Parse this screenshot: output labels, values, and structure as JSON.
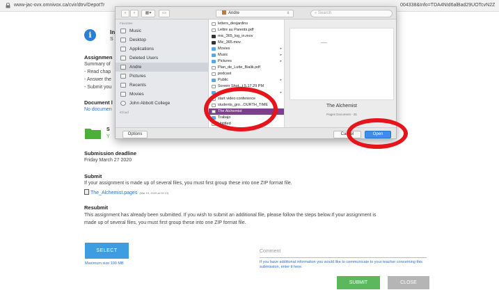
{
  "browser": {
    "url_left": "www-jac-ovx.omnivox.ca/cvir/dtrv/DepotTr",
    "url_right": "004338&Info=TDA4NId6alBad29UOTcvN2Z"
  },
  "page": {
    "partial_heading": "In",
    "partial_sub": "S",
    "assignment_title": "Assignmen",
    "summary_lines": [
      "Summary of",
      "- Read chap",
      "- Answer the",
      "- Submit you"
    ],
    "document_title": "Document l",
    "document_link": "No documen",
    "folder_letter": "S",
    "folder_sub": "Y",
    "deadline_title": "Submission deadline",
    "deadline_value": "Friday March 27 2020",
    "submit_title": "Submit",
    "submit_text": "If your assignment is made up of several files, you must first group these into one ZIP format file.",
    "file_name": "The_Alchemist.pages",
    "file_meta": "(Mar 19, 2020 at 10:13)",
    "resubmit_title": "Resubmit",
    "resubmit_line1": "This assignment has already been submitted. If you wish to submit an additional file, please follow the steps below.If your assignment is",
    "resubmit_line2": "made up of several files, you must first group these into one ZIP format file.",
    "select_label": "SELECT",
    "max_size": "Maximum size 100 MB",
    "comment_placeholder": "Comment",
    "comment_hint": "If you have additional information you would like to communicate to your teacher concerning this submission, enter it here.",
    "submit_label": "SUBMIT",
    "close_label": "CLOSE"
  },
  "dialog": {
    "location": "Andre",
    "search_placeholder": "Search",
    "sidebar_heading_favorites": "Favorites",
    "sidebar_heading_icloud": "iCloud",
    "sidebar_items": [
      "Music",
      "Desktop",
      "Applications",
      "Deleted Users",
      "Andre",
      "Pictures",
      "Recents",
      "Movies",
      "John Abbott College"
    ],
    "files": [
      {
        "name": "letters_desjardins",
        "kind": "doc"
      },
      {
        "name": "Lettre au Parents.pdf",
        "kind": "doc"
      },
      {
        "name": "mic_365_log_in.mov",
        "kind": "dark"
      },
      {
        "name": "Mic_365.mov",
        "kind": "dark"
      },
      {
        "name": "Movies",
        "kind": "folder",
        "arrow": "▸"
      },
      {
        "name": "Music",
        "kind": "folder",
        "arrow": "▸"
      },
      {
        "name": "Pictures",
        "kind": "folder",
        "arrow": "▸"
      },
      {
        "name": "Plan_de_Lutte_Bialik.pdf",
        "kind": "doc"
      },
      {
        "name": "podcast",
        "kind": "doc"
      },
      {
        "name": "Public",
        "kind": "folder",
        "arrow": "▸"
      },
      {
        "name": "Screen Shot...t 5.17.29 PM",
        "kind": "doc"
      },
      {
        "name": "",
        "kind": "folder",
        "arrow": "▸"
      },
      {
        "name": "start video conference",
        "kind": "doc"
      },
      {
        "name": "students_gro...OURTH_TIME",
        "kind": "doc"
      },
      {
        "name": "The Alchemist",
        "kind": "doc",
        "selected": true
      },
      {
        "name": "Trabajo",
        "kind": "folder"
      },
      {
        "name": "Untitled",
        "kind": "doc"
      }
    ],
    "preview_name": "The Alchemist",
    "preview_kind": "Pages Document - 35",
    "options_label": "Options",
    "cancel_label": "Cancel",
    "open_label": "Open"
  },
  "colors": {
    "annotation": "#e6141b",
    "selection": "#7d3f8c",
    "accent": "#3d9de0",
    "submit": "#5cb85c"
  },
  "icons": [
    "lock-icon",
    "info-icon",
    "folder-icon",
    "file-icon",
    "grid-view-icon",
    "folder-toolbar-icon",
    "home-icon",
    "chevron-left-icon",
    "chevron-right-icon",
    "search-icon"
  ]
}
